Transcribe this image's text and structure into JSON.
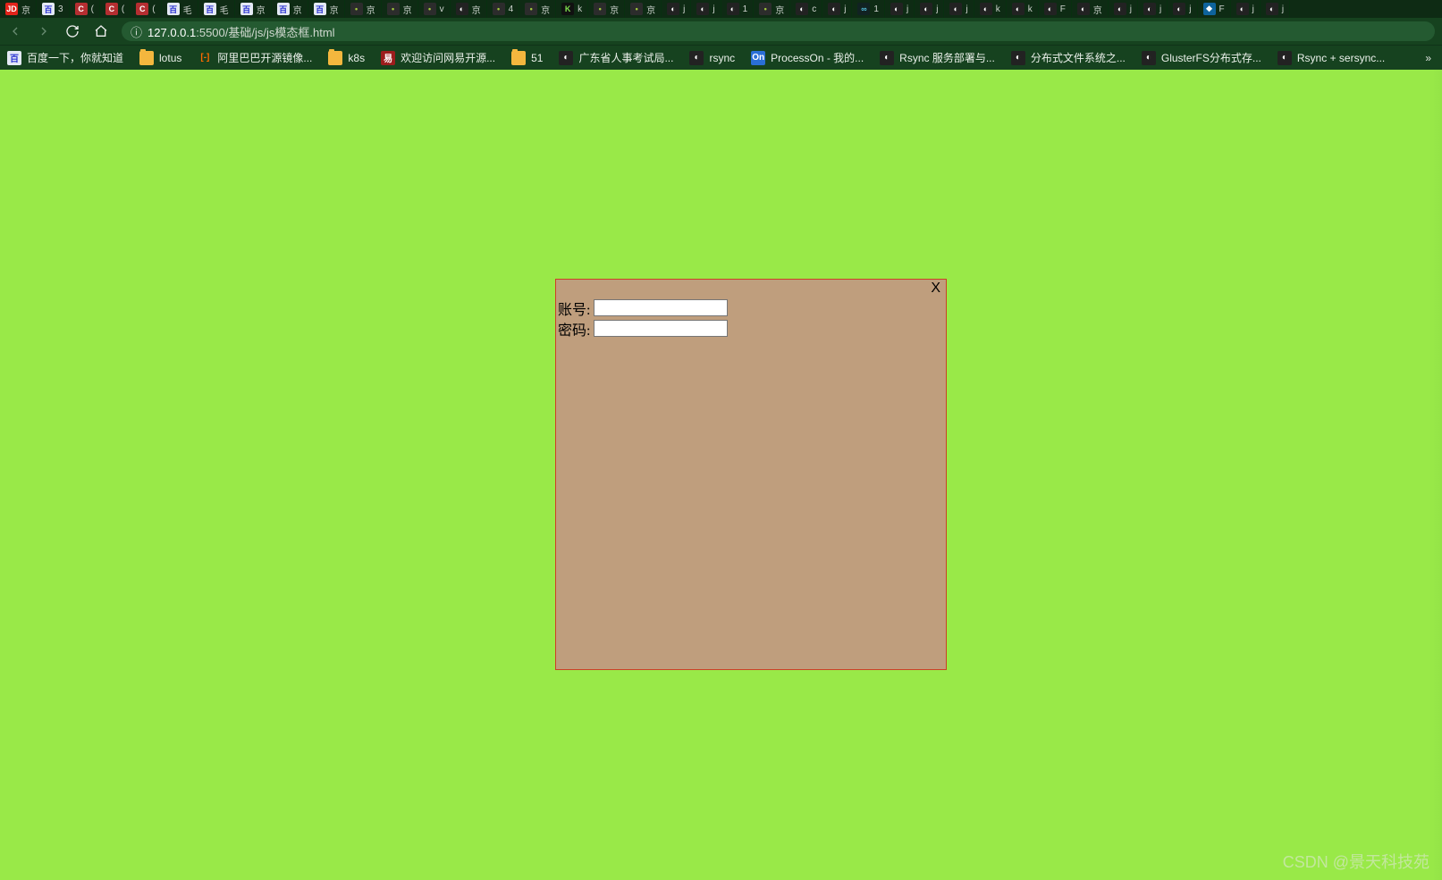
{
  "tabs": [
    {
      "fav": "fav-jd",
      "glyph": "JD",
      "title": "京"
    },
    {
      "fav": "fav-baidu",
      "glyph": "百",
      "title": "3"
    },
    {
      "fav": "fav-c",
      "glyph": "C",
      "title": "("
    },
    {
      "fav": "fav-c",
      "glyph": "C",
      "title": "("
    },
    {
      "fav": "fav-c",
      "glyph": "C",
      "title": "("
    },
    {
      "fav": "fav-baidu",
      "glyph": "百",
      "title": "毛"
    },
    {
      "fav": "fav-baidu",
      "glyph": "百",
      "title": "毛"
    },
    {
      "fav": "fav-baidu",
      "glyph": "百",
      "title": "京"
    },
    {
      "fav": "fav-baidu",
      "glyph": "百",
      "title": "京"
    },
    {
      "fav": "fav-baidu",
      "glyph": "百",
      "title": "京"
    },
    {
      "fav": "fav-dot",
      "glyph": "•",
      "title": "京"
    },
    {
      "fav": "fav-dot",
      "glyph": "•",
      "title": "京"
    },
    {
      "fav": "fav-dot",
      "glyph": "•",
      "title": "v"
    },
    {
      "fav": "fav-globe",
      "glyph": "◐",
      "title": "京"
    },
    {
      "fav": "fav-dot",
      "glyph": "•",
      "title": "4"
    },
    {
      "fav": "fav-dot",
      "glyph": "•",
      "title": "京"
    },
    {
      "fav": "fav-k",
      "glyph": "K",
      "title": "k"
    },
    {
      "fav": "fav-dot",
      "glyph": "•",
      "title": "京"
    },
    {
      "fav": "fav-dot",
      "glyph": "•",
      "title": "京"
    },
    {
      "fav": "fav-globe",
      "glyph": "◐",
      "title": "j"
    },
    {
      "fav": "fav-globe",
      "glyph": "◐",
      "title": "j"
    },
    {
      "fav": "fav-globe",
      "glyph": "◐",
      "title": "1"
    },
    {
      "fav": "fav-dot",
      "glyph": "•",
      "title": "京"
    },
    {
      "fav": "fav-globe",
      "glyph": "◐",
      "title": "c"
    },
    {
      "fav": "fav-globe",
      "glyph": "◐",
      "title": "j"
    },
    {
      "fav": "fav-inf",
      "glyph": "∞",
      "title": "1"
    },
    {
      "fav": "fav-globe",
      "glyph": "◐",
      "title": "j"
    },
    {
      "fav": "fav-globe",
      "glyph": "◐",
      "title": "j"
    },
    {
      "fav": "fav-globe",
      "glyph": "◐",
      "title": "j"
    },
    {
      "fav": "fav-globe",
      "glyph": "◐",
      "title": "k"
    },
    {
      "fav": "fav-globe",
      "glyph": "◐",
      "title": "k"
    },
    {
      "fav": "fav-globe",
      "glyph": "◐",
      "title": "F"
    },
    {
      "fav": "fav-globe",
      "glyph": "◐",
      "title": "京"
    },
    {
      "fav": "fav-globe",
      "glyph": "◐",
      "title": "j"
    },
    {
      "fav": "fav-globe",
      "glyph": "◐",
      "title": "j"
    },
    {
      "fav": "fav-globe",
      "glyph": "◐",
      "title": "j"
    },
    {
      "fav": "fav-vs",
      "glyph": "❖",
      "title": "F"
    },
    {
      "fav": "fav-globe",
      "glyph": "◐",
      "title": "j"
    },
    {
      "fav": "fav-globe",
      "glyph": "◐",
      "title": "j"
    }
  ],
  "address": {
    "info_glyph": "ⓘ",
    "host": "127.0.0.1",
    "port": ":5500",
    "path": "/基础/js/js模态框.html"
  },
  "bookmarks": [
    {
      "icon": "bi-baidu",
      "glyph": "百",
      "label": "百度一下，你就知道"
    },
    {
      "icon": "bi-folder",
      "glyph": "",
      "label": "lotus"
    },
    {
      "icon": "bi-ali",
      "glyph": "[-]",
      "label": "阿里巴巴开源镜像..."
    },
    {
      "icon": "bi-folder",
      "glyph": "",
      "label": "k8s"
    },
    {
      "icon": "bi-163",
      "glyph": "易",
      "label": "欢迎访问网易开源..."
    },
    {
      "icon": "bi-folder",
      "glyph": "",
      "label": "51"
    },
    {
      "icon": "bi-globe",
      "glyph": "◐",
      "label": "广东省人事考试局..."
    },
    {
      "icon": "bi-globe",
      "glyph": "◐",
      "label": "rsync"
    },
    {
      "icon": "bi-on",
      "glyph": "On",
      "label": "ProcessOn - 我的..."
    },
    {
      "icon": "bi-globe",
      "glyph": "◐",
      "label": "Rsync 服务部署与..."
    },
    {
      "icon": "bi-globe",
      "glyph": "◐",
      "label": "分布式文件系统之..."
    },
    {
      "icon": "bi-globe",
      "glyph": "◐",
      "label": "GlusterFS分布式存..."
    },
    {
      "icon": "bi-globe",
      "glyph": "◐",
      "label": "Rsync + sersync..."
    }
  ],
  "modal": {
    "close": "X",
    "username_label": "账号:",
    "password_label": "密码:",
    "username_value": "",
    "password_value": ""
  },
  "watermark": "CSDN @景天科技苑"
}
